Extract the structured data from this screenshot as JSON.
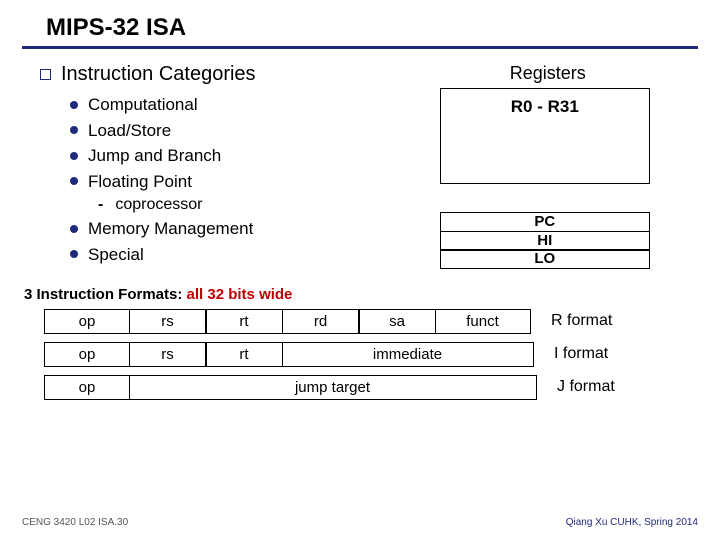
{
  "title": "MIPS-32 ISA",
  "section_heading": "Instruction Categories",
  "categories1": {
    "i0": "Computational",
    "i1": "Load/Store",
    "i2": "Jump and Branch",
    "i3": "Floating Point"
  },
  "sub": "coprocessor",
  "categories2": {
    "i0": "Memory Management",
    "i1": "Special"
  },
  "registers": {
    "heading": "Registers",
    "range": "R0 - R31",
    "s0": "PC",
    "s1": "HI",
    "s2": "LO"
  },
  "formats_heading": {
    "a": "3 Instruction Formats: ",
    "b": "all 32 bits wide"
  },
  "fields": {
    "op": "op",
    "rs": "rs",
    "rt": "rt",
    "rd": "rd",
    "sa": "sa",
    "funct": "funct",
    "imm": "immediate",
    "jmp": "jump target"
  },
  "format_labels": {
    "r": "R format",
    "i": "I format",
    "j": "J format"
  },
  "footer": {
    "left": "CENG 3420 L02 ISA.30",
    "right": "Qiang Xu   CUHK, Spring 2014"
  }
}
